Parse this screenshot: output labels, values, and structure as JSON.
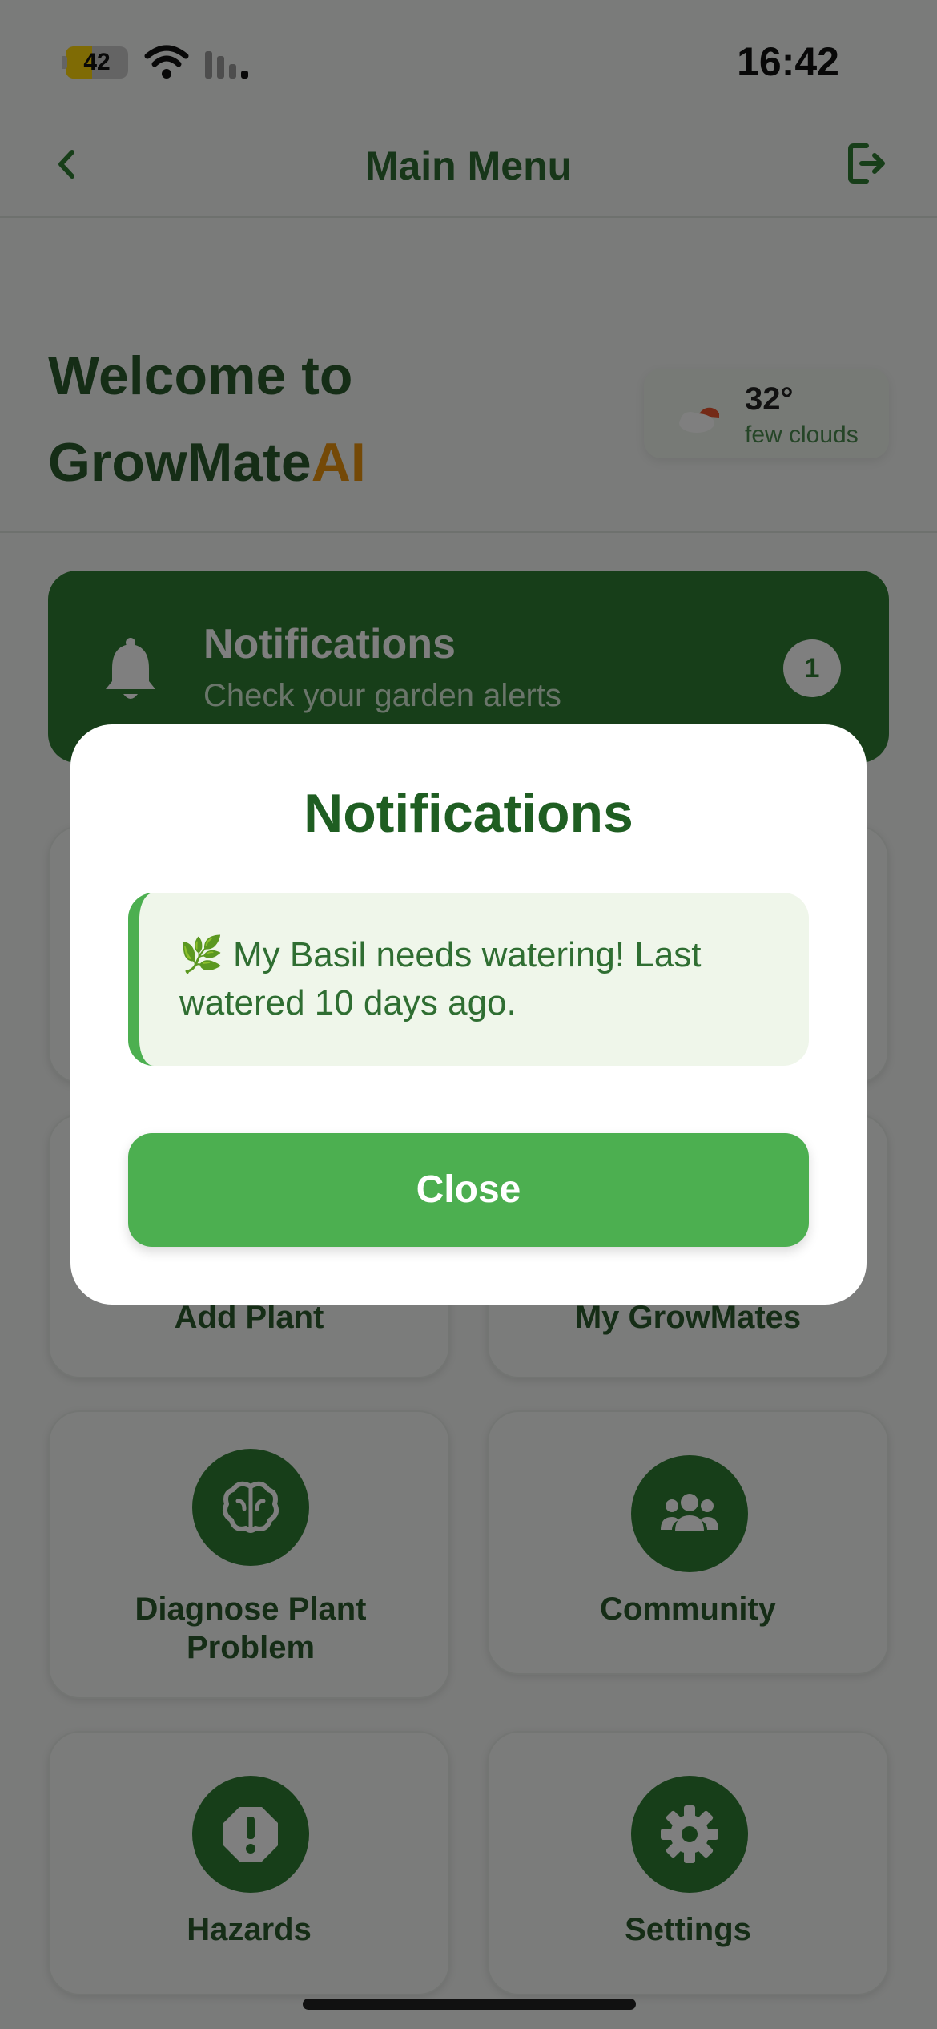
{
  "status_bar": {
    "time": "16:42",
    "battery_level": "42",
    "battery_fraction": 0.42
  },
  "nav": {
    "title": "Main Menu"
  },
  "header": {
    "welcome_line1": "Welcome to",
    "brand_main": "GrowMate",
    "brand_accent": "AI"
  },
  "weather": {
    "temp": "32°",
    "desc": "few clouds",
    "icon": "partly-cloudy-icon"
  },
  "notifications_card": {
    "title": "Notifications",
    "subtitle": "Check your garden alerts",
    "count": "1"
  },
  "tiles": [
    {
      "label": "Add Plant",
      "icon": "add-plant-icon"
    },
    {
      "label": "My GrowMates",
      "icon": "plants-icon"
    },
    {
      "label": "Diagnose Plant Problem",
      "icon": "brain-icon"
    },
    {
      "label": "Community",
      "icon": "users-icon"
    },
    {
      "label": "Hazards",
      "icon": "warning-icon"
    },
    {
      "label": "Settings",
      "icon": "gear-icon"
    }
  ],
  "modal": {
    "title": "Notifications",
    "message": "🌿 My Basil needs watering! Last watered 10 days ago.",
    "close_label": "Close"
  },
  "colors": {
    "primary": "#2e7d32",
    "accent": "#e8920f",
    "button": "#4caf50",
    "alert_bg": "#eff6ea"
  }
}
